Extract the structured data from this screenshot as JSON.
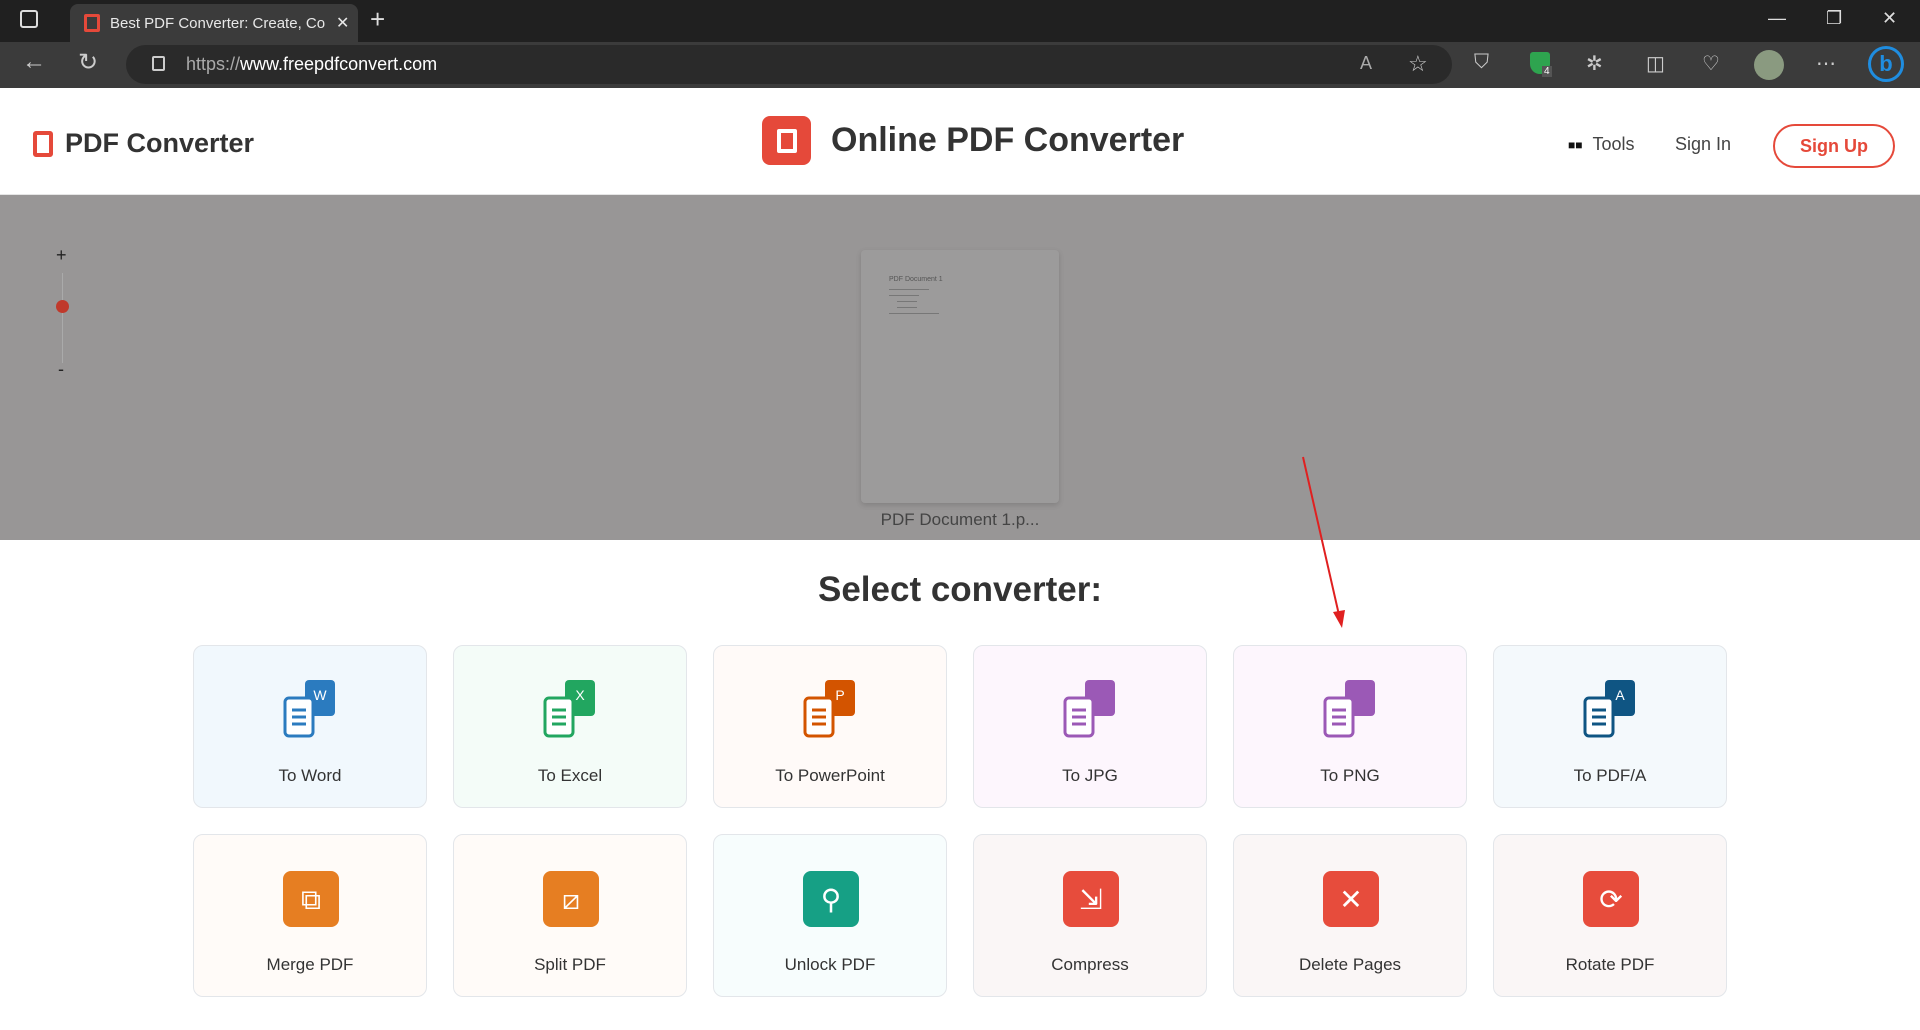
{
  "browser": {
    "tab_title": "Best PDF Converter: Create, Conv",
    "url_protocol": "https://",
    "url_host": "www.freepdfconvert.com",
    "extension_badge": "4"
  },
  "header": {
    "brand": "PDF Converter",
    "center_title": "Online PDF Converter",
    "tools_label": "Tools",
    "sign_in": "Sign In",
    "sign_up": "Sign Up",
    "accent": "#e5493a"
  },
  "preview": {
    "zoom_plus": "+",
    "zoom_minus": "-",
    "doc_title": "PDF Document 1",
    "doc_caption": "PDF Document 1.p...",
    "zoom_level": 0.3
  },
  "main": {
    "heading": "Select converter:",
    "converters": [
      {
        "label": "To Word",
        "icon": "word-icon",
        "color": "#2b7bbf",
        "bg": "#f1f8fd",
        "letter": "W"
      },
      {
        "label": "To Excel",
        "icon": "excel-icon",
        "color": "#22a660",
        "bg": "#f4fcf8",
        "letter": "X"
      },
      {
        "label": "To PowerPoint",
        "icon": "powerpoint-icon",
        "color": "#d35400",
        "bg": "#fffaf8",
        "letter": "P"
      },
      {
        "label": "To JPG",
        "icon": "jpg-icon",
        "color": "#9b59b6",
        "bg": "#fdf6fd",
        "letter": ""
      },
      {
        "label": "To PNG",
        "icon": "png-icon",
        "color": "#9b59b6",
        "bg": "#fdf6fd",
        "letter": ""
      },
      {
        "label": "To PDF/A",
        "icon": "pdfa-icon",
        "color": "#0f5583",
        "bg": "#f4f9fc",
        "letter": "A"
      },
      {
        "label": "Merge PDF",
        "icon": "merge-icon",
        "color": "#e67e22",
        "bg": "#fffbf8"
      },
      {
        "label": "Split PDF",
        "icon": "split-icon",
        "color": "#e67e22",
        "bg": "#fffbf8"
      },
      {
        "label": "Unlock PDF",
        "icon": "unlock-icon",
        "color": "#16a085",
        "bg": "#f7fdfd"
      },
      {
        "label": "Compress",
        "icon": "compress-icon",
        "color": "#e74c3c",
        "bg": "#faf6f6"
      },
      {
        "label": "Delete Pages",
        "icon": "delete-icon",
        "color": "#e74c3c",
        "bg": "#faf6f6"
      },
      {
        "label": "Rotate PDF",
        "icon": "rotate-icon",
        "color": "#e74c3c",
        "bg": "#faf6f6"
      }
    ]
  }
}
